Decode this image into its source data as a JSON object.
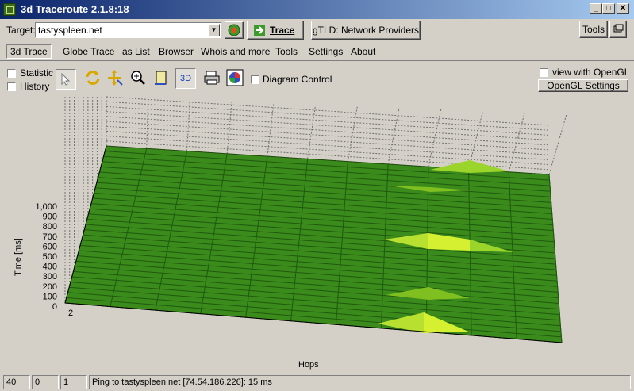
{
  "window": {
    "title": "3d Traceroute 2.1.8:18",
    "minimize": "_",
    "maximize": "□",
    "close": "✕"
  },
  "target": {
    "label": "Target:",
    "value": "tastyspleen.net",
    "trace_label": "Trace",
    "gtld_label": "gTLD: Network Providers",
    "tools_label": "Tools"
  },
  "menu": {
    "items": [
      "3d Trace",
      "Globe Trace",
      "as List",
      "Browser",
      "Whois and more",
      "Tools",
      "Settings",
      "About"
    ]
  },
  "toolbar": {
    "statistic_label": "Statistic",
    "history_label": "History",
    "three_d_label": "3D",
    "diagram_control_label": "Diagram Control",
    "opengl_view_label": "view with OpenGL",
    "opengl_settings_label": "OpenGL Settings"
  },
  "chart_data": {
    "type": "area",
    "xlabel": "Hops",
    "ylabel": "Time [ms]",
    "ylim": [
      0,
      1000
    ],
    "y_ticks": [
      "1,000",
      "900",
      "800",
      "700",
      "600",
      "500",
      "400",
      "300",
      "200",
      "100",
      "0"
    ],
    "x_ticks": [
      "2"
    ],
    "colors": {
      "surface": "#3a8a1c",
      "surface_dark": "#2f7414",
      "highlight": "#9bd42a",
      "highlight_bright": "#d4f030",
      "grid": "#808080"
    }
  },
  "status": {
    "panes": [
      "40",
      "0",
      "1"
    ],
    "message": "Ping to tastyspleen.net [74.54.186.226]: 15 ms"
  }
}
